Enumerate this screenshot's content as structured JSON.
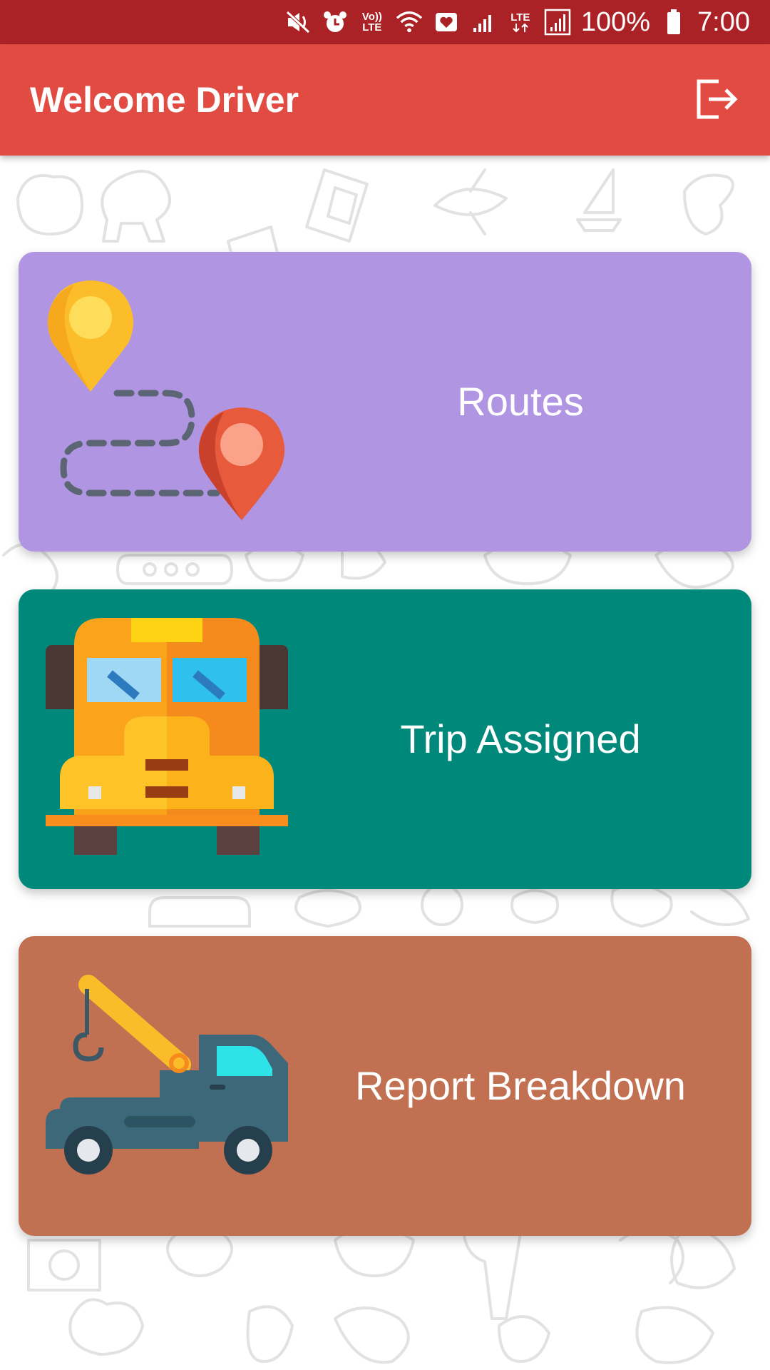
{
  "status_bar": {
    "volte_top": "Vo))",
    "volte_bottom": "LTE",
    "lte_label": "LTE",
    "battery_percent": "100%",
    "time": "7:00",
    "icons": [
      "mute-vibrate-icon",
      "alarm-icon",
      "volte-icon",
      "wifi-icon",
      "health-app-icon",
      "signal-icon",
      "lte-signal-icon",
      "battery-icon"
    ]
  },
  "app_bar": {
    "title": "Welcome Driver",
    "action_icon": "logout-icon"
  },
  "menu": {
    "items": [
      {
        "label": "Routes",
        "icon": "route-map-pins-icon",
        "color": "#b095e2"
      },
      {
        "label": "Trip Assigned",
        "icon": "school-bus-icon",
        "color": "#00897b"
      },
      {
        "label": "Report Breakdown",
        "icon": "tow-truck-icon",
        "color": "#c17152"
      }
    ]
  },
  "colors": {
    "status_bar": "#ab2226",
    "app_bar": "#e24b42",
    "background": "#ffffff",
    "doodle": "#e2e2e2"
  }
}
